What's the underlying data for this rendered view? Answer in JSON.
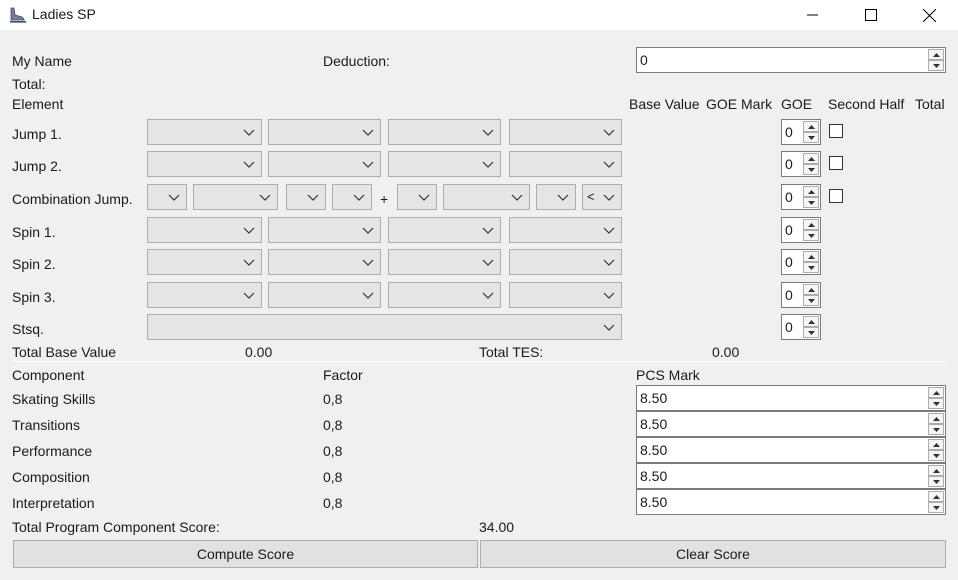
{
  "window": {
    "title": "Ladies SP"
  },
  "header": {
    "my_name": "My Name",
    "deduction_label": "Deduction:",
    "deduction_value": "0",
    "total_label": "Total:"
  },
  "columns": {
    "element": "Element",
    "base_value": "Base Value",
    "goe_mark": "GOE Mark",
    "goe": "GOE",
    "second_half": "Second Half",
    "total": "Total"
  },
  "elements": [
    {
      "label": "Jump 1.",
      "goe": "0"
    },
    {
      "label": "Jump 2.",
      "goe": "0"
    },
    {
      "label": "Combination Jump.",
      "goe": "0",
      "plus": "+",
      "last_combo_value": "<"
    },
    {
      "label": "Spin 1.",
      "goe": "0"
    },
    {
      "label": "Spin 2.",
      "goe": "0"
    },
    {
      "label": "Spin 3.",
      "goe": "0"
    },
    {
      "label": "Stsq.",
      "goe": "0"
    }
  ],
  "tes": {
    "total_base_label": "Total Base Value",
    "total_base_value": "0.00",
    "total_tes_label": "Total TES:",
    "total_tes_value": "0.00"
  },
  "pcs": {
    "component_header": "Component",
    "factor_header": "Factor",
    "mark_header": "PCS Mark",
    "rows": [
      {
        "component": "Skating Skills",
        "factor": "0,8",
        "mark": "8.50"
      },
      {
        "component": "Transitions",
        "factor": "0,8",
        "mark": "8.50"
      },
      {
        "component": "Performance",
        "factor": "0,8",
        "mark": "8.50"
      },
      {
        "component": "Composition",
        "factor": "0,8",
        "mark": "8.50"
      },
      {
        "component": "Interpretation",
        "factor": "0,8",
        "mark": "8.50"
      }
    ],
    "total_label": "Total Program Component Score:",
    "total_value": "34.00"
  },
  "buttons": {
    "compute": "Compute Score",
    "clear": "Clear Score"
  }
}
